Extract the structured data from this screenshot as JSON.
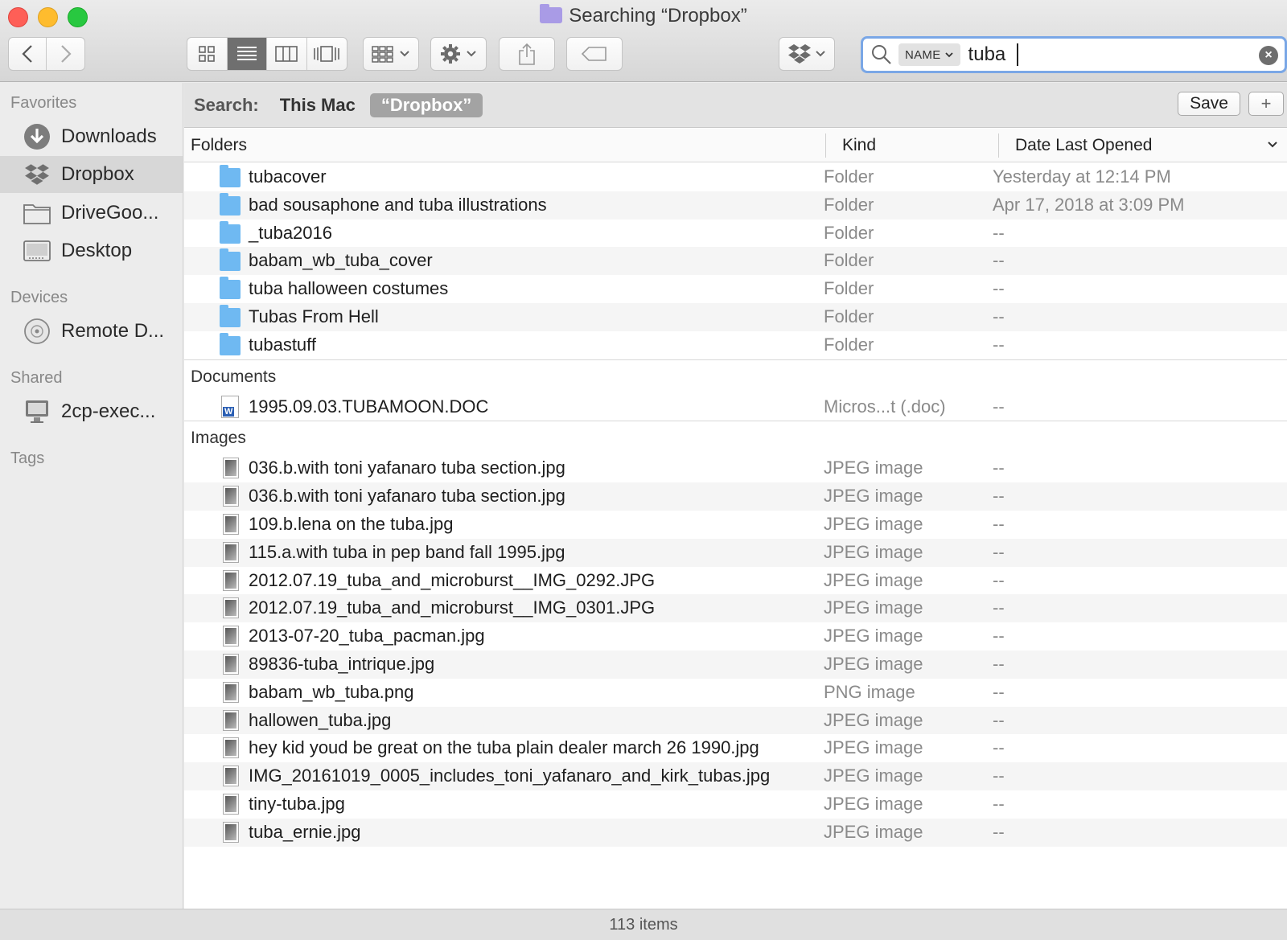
{
  "window": {
    "title": "Searching “Dropbox”"
  },
  "toolbar": {
    "back_icon": "chevron-left-icon",
    "forward_icon": "chevron-right-icon",
    "view_modes": [
      "icon-view",
      "list-view",
      "column-view",
      "cover-flow-view"
    ],
    "active_view": "list-view"
  },
  "search": {
    "token": "NAME",
    "value": "tuba"
  },
  "sidebar": {
    "favorites_header": "Favorites",
    "favorites": [
      {
        "label": "Downloads",
        "icon": "download-icon"
      },
      {
        "label": "Dropbox",
        "icon": "dropbox-icon",
        "selected": true
      },
      {
        "label": "DriveGoo...",
        "icon": "folder-icon"
      },
      {
        "label": "Desktop",
        "icon": "desktop-icon"
      }
    ],
    "devices_header": "Devices",
    "devices": [
      {
        "label": "Remote D...",
        "icon": "disc-icon"
      }
    ],
    "shared_header": "Shared",
    "shared": [
      {
        "label": "2cp-exec...",
        "icon": "computer-icon"
      }
    ],
    "tags_header": "Tags"
  },
  "scope": {
    "label": "Search:",
    "this_mac": "This Mac",
    "dropbox": "“Dropbox”",
    "save": "Save",
    "plus": "+"
  },
  "columns": {
    "name": "Folders",
    "kind": "Kind",
    "date": "Date Last Opened"
  },
  "groups": {
    "documents": "Documents",
    "images": "Images"
  },
  "folders": [
    {
      "name": "tubacover",
      "kind": "Folder",
      "date": "Yesterday at 12:14 PM"
    },
    {
      "name": "bad sousaphone and tuba illustrations",
      "kind": "Folder",
      "date": "Apr 17, 2018 at 3:09 PM"
    },
    {
      "name": "_tuba2016",
      "kind": "Folder",
      "date": "--"
    },
    {
      "name": "babam_wb_tuba_cover",
      "kind": "Folder",
      "date": "--"
    },
    {
      "name": "tuba halloween costumes",
      "kind": "Folder",
      "date": "--"
    },
    {
      "name": "Tubas From Hell",
      "kind": "Folder",
      "date": "--"
    },
    {
      "name": "tubastuff",
      "kind": "Folder",
      "date": "--"
    }
  ],
  "documents": [
    {
      "name": "1995.09.03.TUBAMOON.DOC",
      "kind": "Micros...t (.doc)",
      "date": "--"
    }
  ],
  "images": [
    {
      "name": "036.b.with toni yafanaro tuba section.jpg",
      "kind": "JPEG image",
      "date": "--"
    },
    {
      "name": "036.b.with toni yafanaro tuba section.jpg",
      "kind": "JPEG image",
      "date": "--"
    },
    {
      "name": "109.b.lena on the tuba.jpg",
      "kind": "JPEG image",
      "date": "--"
    },
    {
      "name": "115.a.with tuba in pep band fall 1995.jpg",
      "kind": "JPEG image",
      "date": "--"
    },
    {
      "name": "2012.07.19_tuba_and_microburst__IMG_0292.JPG",
      "kind": "JPEG image",
      "date": "--"
    },
    {
      "name": "2012.07.19_tuba_and_microburst__IMG_0301.JPG",
      "kind": "JPEG image",
      "date": "--"
    },
    {
      "name": "2013-07-20_tuba_pacman.jpg",
      "kind": "JPEG image",
      "date": "--"
    },
    {
      "name": "89836-tuba_intrique.jpg",
      "kind": "JPEG image",
      "date": "--"
    },
    {
      "name": "babam_wb_tuba.png",
      "kind": "PNG image",
      "date": "--"
    },
    {
      "name": "hallowen_tuba.jpg",
      "kind": "JPEG image",
      "date": "--"
    },
    {
      "name": "hey kid youd be great on the tuba plain dealer march 26 1990.jpg",
      "kind": "JPEG image",
      "date": "--"
    },
    {
      "name": "IMG_20161019_0005_includes_toni_yafanaro_and_kirk_tubas.jpg",
      "kind": "JPEG image",
      "date": "--"
    },
    {
      "name": "tiny-tuba.jpg",
      "kind": "JPEG image",
      "date": "--"
    },
    {
      "name": "tuba_ernie.jpg",
      "kind": "JPEG image",
      "date": "--"
    }
  ],
  "status": {
    "count": "113 items"
  },
  "colors": {
    "accent": "#7aa7e6",
    "folder": "#6fb9f2",
    "selected_sidebar": "#d7d7d7"
  }
}
